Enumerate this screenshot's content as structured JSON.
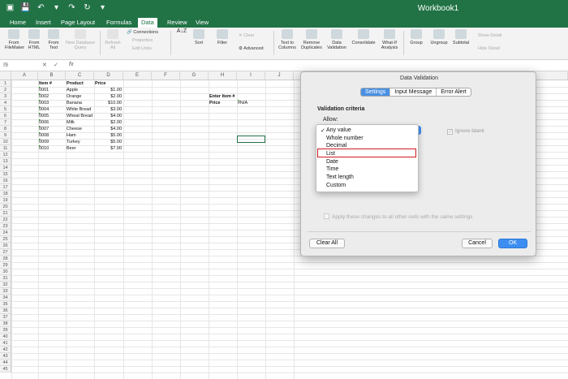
{
  "window": {
    "title": "Workbook1"
  },
  "quick_access": [
    "save-icon",
    "undo-icon",
    "redo-icon",
    "repeat-icon"
  ],
  "tabs": [
    "Home",
    "Insert",
    "Page Layout",
    "Formulas",
    "Data",
    "Review",
    "View"
  ],
  "active_tab": "Data",
  "ribbon": {
    "from_filemaker": "From FileMaker",
    "from_html": "From HTML",
    "from_text": "From Text",
    "new_database_query": "New Database Query",
    "refresh_all": "Refresh All",
    "connections": "Connections",
    "properties": "Properties",
    "edit_links": "Edit Links",
    "sort_az": "A↓Z",
    "sort": "Sort",
    "filter": "Filter",
    "clear": "Clear",
    "advanced": "Advanced",
    "text_to_columns": "Text to Columns",
    "remove_duplicates": "Remove Duplicates",
    "data_validation": "Data Validation",
    "consolidate": "Consolidate",
    "what_if": "What-If Analysis",
    "group": "Group",
    "ungroup": "Ungroup",
    "subtotal": "Subtotal",
    "show_detail": "Show Detail",
    "hide_detail": "Hide Detail"
  },
  "formula_bar": {
    "name_box": "I9",
    "fx": "fx",
    "value": ""
  },
  "columns": [
    "A",
    "B",
    "C",
    "D",
    "E",
    "F",
    "G",
    "H",
    "I",
    "J"
  ],
  "rows": [
    "1",
    "2",
    "3",
    "4",
    "5",
    "6",
    "7",
    "8",
    "9",
    "10",
    "11",
    "12",
    "13",
    "14",
    "15",
    "16",
    "17",
    "18",
    "19",
    "20",
    "21",
    "22",
    "23",
    "24",
    "25",
    "26",
    "27",
    "28",
    "29",
    "30",
    "31",
    "32",
    "33",
    "34",
    "35",
    "36",
    "37",
    "38",
    "39",
    "40",
    "41",
    "42",
    "43",
    "44",
    "45"
  ],
  "table": {
    "headers": [
      "Item #",
      "Product",
      "Price"
    ],
    "rows": [
      [
        "0001",
        "Apple",
        "$1.00"
      ],
      [
        "0002",
        "Orange",
        "$2.00"
      ],
      [
        "0003",
        "Banana",
        "$10.00"
      ],
      [
        "0004",
        "White Bread",
        "$3.00"
      ],
      [
        "0005",
        "Wheat Bread",
        "$4.00"
      ],
      [
        "0006",
        "Milk",
        "$2.00"
      ],
      [
        "0007",
        "Cheese",
        "$4.00"
      ],
      [
        "0008",
        "Ham",
        "$5.00"
      ],
      [
        "0009",
        "Turkey",
        "$5.00"
      ],
      [
        "0010",
        "Beer",
        "$7.00"
      ]
    ]
  },
  "lookup": {
    "enter_label": "Enter Item #",
    "price_label": "Price",
    "price_value": "#N/A"
  },
  "dialog": {
    "title": "Data Validation",
    "tabs": [
      "Settings",
      "Input Message",
      "Error Alert"
    ],
    "active_tab": "Settings",
    "criteria_heading": "Validation criteria",
    "allow_label": "Allow:",
    "allow_options": [
      "Any value",
      "Whole number",
      "Decimal",
      "List",
      "Date",
      "Time",
      "Text length",
      "Custom"
    ],
    "selected_option": "Any value",
    "highlighted_option": "List",
    "ignore_blank": "Ignore blank",
    "ignore_blank_checked": true,
    "apply_all": "Apply these changes to all other cells with the same settings",
    "clear_all": "Clear All",
    "cancel": "Cancel",
    "ok": "OK"
  },
  "colors": {
    "excel_green": "#217346",
    "accent_blue": "#3d8ef0",
    "highlight_red": "#d0191d"
  }
}
